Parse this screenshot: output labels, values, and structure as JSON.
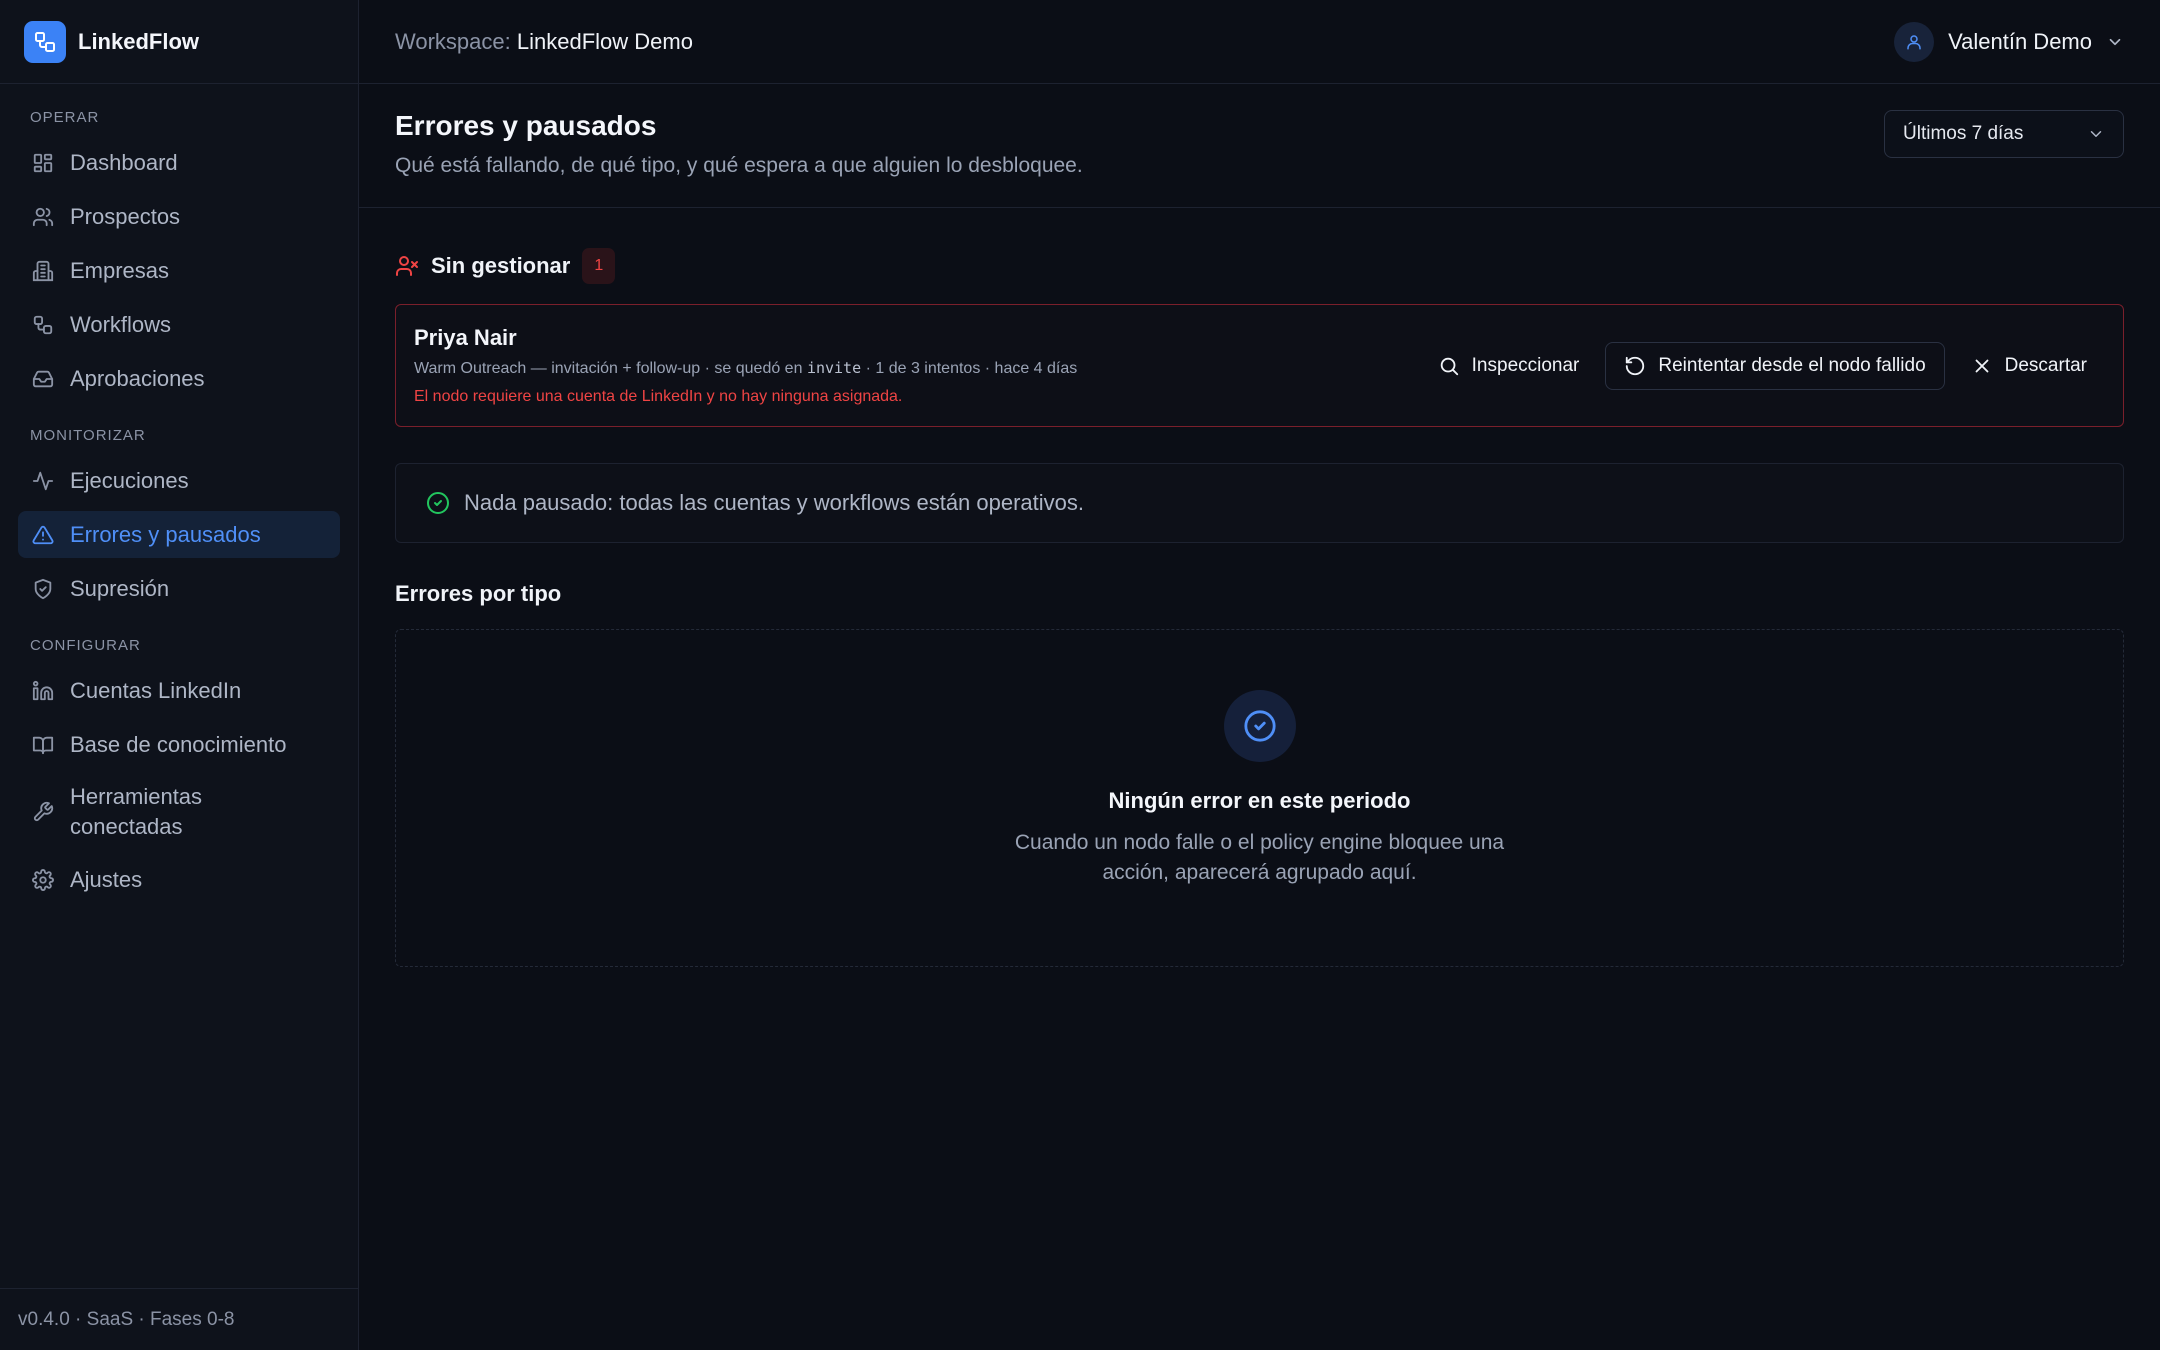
{
  "brand": {
    "name": "LinkedFlow"
  },
  "sidebar": {
    "sections": {
      "operar": "OPERAR",
      "monitorizar": "MONITORIZAR",
      "configurar": "CONFIGURAR"
    },
    "items": {
      "dashboard": "Dashboard",
      "prospectos": "Prospectos",
      "empresas": "Empresas",
      "workflows": "Workflows",
      "aprobaciones": "Aprobaciones",
      "ejecuciones": "Ejecuciones",
      "errores": "Errores y pausados",
      "supresion": "Supresión",
      "cuentas": "Cuentas LinkedIn",
      "base": "Base de conocimiento",
      "herramientas_1": "Herramientas",
      "herramientas_2": "conectadas",
      "ajustes": "Ajustes"
    },
    "active_item": "errores",
    "footer": "v0.4.0 · SaaS · Fases 0-8"
  },
  "topbar": {
    "workspace_label": "Workspace:",
    "workspace_name": "LinkedFlow Demo",
    "user_name": "Valentín Demo"
  },
  "page": {
    "title": "Errores y pausados",
    "subtitle": "Qué está fallando, de qué tipo, y qué espera a que alguien lo desbloquee.",
    "period": "Últimos 7 días"
  },
  "unmanaged": {
    "title": "Sin gestionar",
    "count": "1",
    "item": {
      "name": "Priya Nair",
      "meta_before": "Warm Outreach — invitación + follow-up · se quedó en",
      "meta_node": "invite",
      "meta_after": "· 1 de 3 intentos · hace 4 días",
      "error": "El nodo requiere una cuenta de LinkedIn y no hay ninguna asignada."
    },
    "actions": {
      "inspect": "Inspeccionar",
      "retry": "Reintentar desde el nodo fallido",
      "dismiss": "Descartar"
    }
  },
  "paused_banner": "Nada pausado: todas las cuentas y workflows están operativos.",
  "error_types": {
    "title": "Errores por tipo",
    "empty_title": "Ningún error en este periodo",
    "empty_desc": "Cuando un nodo falle o el policy engine bloquee una acción, aparecerá agrupado aquí."
  },
  "colors": {
    "accent": "#3b82f6",
    "danger": "#ef4444",
    "success": "#22c55e",
    "background": "#0b0e16"
  }
}
